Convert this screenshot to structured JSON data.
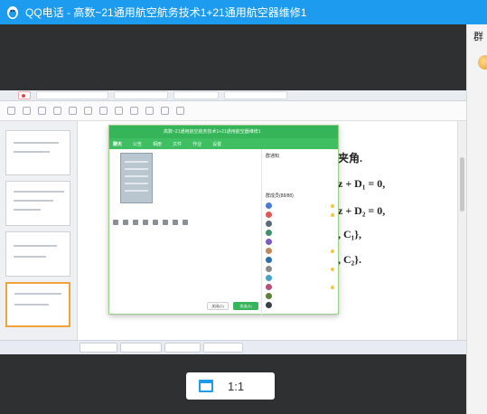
{
  "window": {
    "title": "QQ电话 - 高数~21通用航空航务技术1+21通用航空器维修1"
  },
  "side_panel": {
    "title": "群"
  },
  "shared_screen": {
    "browser_tabs": [
      "",
      "",
      "",
      "",
      ""
    ],
    "slide_math": [
      "夹角.",
      "z + D₁ = 0,",
      "z + D₂ = 0,",
      ", C₁},",
      ", C₂}."
    ],
    "chat_window": {
      "title": "高数~21通用航空航务技术1+21通用航空器维修1",
      "tabs": [
        "聊天",
        "公告",
        "相册",
        "文件",
        "作业",
        "设置"
      ],
      "notice_title": "群通知",
      "notice_body": "",
      "members_title": "群成员(88/88)",
      "close_button": "关闭(C)",
      "send_button": "发送(S)",
      "members": [
        "",
        "",
        "",
        "",
        "",
        "",
        "",
        "",
        "",
        "",
        "",
        "",
        ""
      ]
    }
  },
  "zoom_control": {
    "ratio": "1:1",
    "icon": "window-icon"
  },
  "colors": {
    "titlebar": "#1d9bef",
    "call_background": "#2e3032",
    "chat_green": "#35b45a"
  }
}
